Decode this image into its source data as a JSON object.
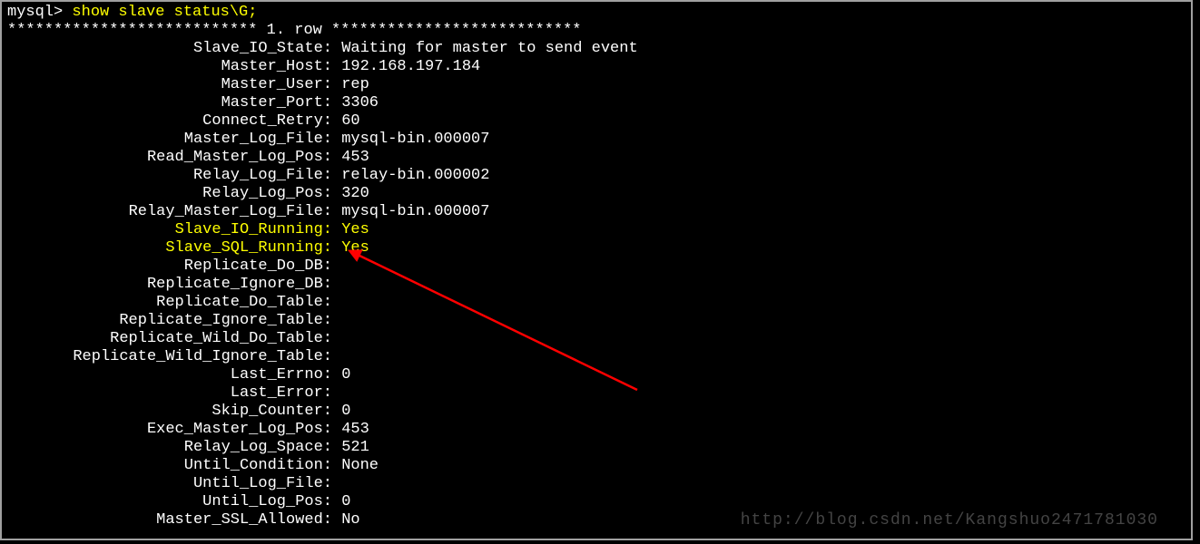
{
  "prompt": "mysql> ",
  "command": "show slave status\\G;",
  "header": "*************************** 1. row ***************************",
  "rows": [
    {
      "label": "Slave_IO_State:",
      "value": "Waiting for master to send event"
    },
    {
      "label": "Master_Host:",
      "value": "192.168.197.184"
    },
    {
      "label": "Master_User:",
      "value": "rep"
    },
    {
      "label": "Master_Port:",
      "value": "3306"
    },
    {
      "label": "Connect_Retry:",
      "value": "60"
    },
    {
      "label": "Master_Log_File:",
      "value": "mysql-bin.000007"
    },
    {
      "label": "Read_Master_Log_Pos:",
      "value": "453"
    },
    {
      "label": "Relay_Log_File:",
      "value": "relay-bin.000002"
    },
    {
      "label": "Relay_Log_Pos:",
      "value": "320"
    },
    {
      "label": "Relay_Master_Log_File:",
      "value": "mysql-bin.000007"
    },
    {
      "label": "Slave_IO_Running:",
      "value": "Yes",
      "hl": true
    },
    {
      "label": "Slave_SQL_Running:",
      "value": "Yes",
      "hl": true
    },
    {
      "label": "Replicate_Do_DB:",
      "value": ""
    },
    {
      "label": "Replicate_Ignore_DB:",
      "value": ""
    },
    {
      "label": "Replicate_Do_Table:",
      "value": ""
    },
    {
      "label": "Replicate_Ignore_Table:",
      "value": ""
    },
    {
      "label": "Replicate_Wild_Do_Table:",
      "value": ""
    },
    {
      "label": "Replicate_Wild_Ignore_Table:",
      "value": ""
    },
    {
      "label": "Last_Errno:",
      "value": "0"
    },
    {
      "label": "Last_Error:",
      "value": ""
    },
    {
      "label": "Skip_Counter:",
      "value": "0"
    },
    {
      "label": "Exec_Master_Log_Pos:",
      "value": "453"
    },
    {
      "label": "Relay_Log_Space:",
      "value": "521"
    },
    {
      "label": "Until_Condition:",
      "value": "None"
    },
    {
      "label": "Until_Log_File:",
      "value": ""
    },
    {
      "label": "Until_Log_Pos:",
      "value": "0"
    },
    {
      "label": "Master_SSL_Allowed:",
      "value": "No"
    }
  ],
  "watermark": "http://blog.csdn.net/Kangshuo2471781030"
}
